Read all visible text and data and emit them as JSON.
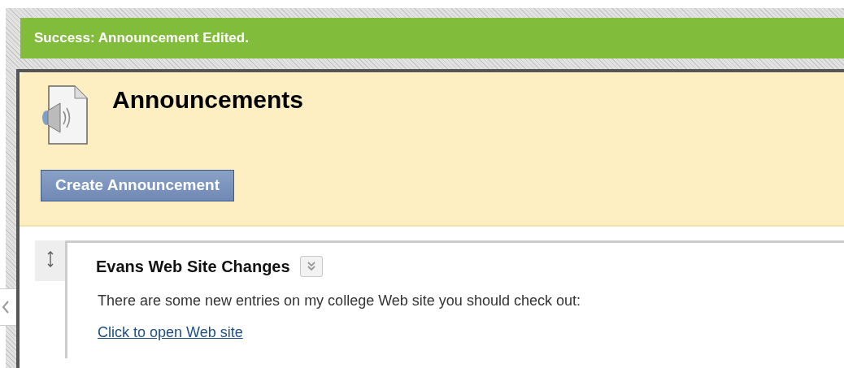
{
  "alert": {
    "text": "Success: Announcement Edited."
  },
  "page": {
    "title": "Announcements"
  },
  "action_button": {
    "label": "Create Announcement"
  },
  "announcements": [
    {
      "title": "Evans Web Site Changes",
      "body": "There are some new entries on my college Web site you should check out:",
      "link": "Click to open Web site"
    }
  ]
}
